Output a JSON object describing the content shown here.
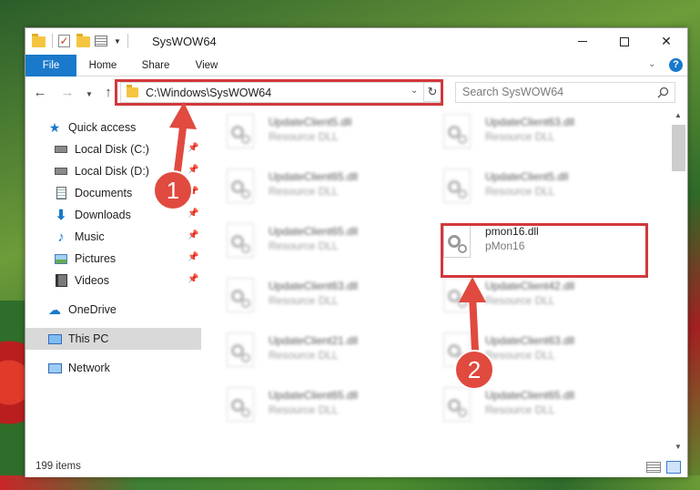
{
  "window": {
    "title": "SysWOW64"
  },
  "ribbon": {
    "tabs": [
      "File",
      "Home",
      "Share",
      "View"
    ]
  },
  "nav": {
    "address": "C:\\Windows\\SysWOW64",
    "search_placeholder": "Search SysWOW64"
  },
  "navpane": {
    "items": [
      {
        "label": "Quick access",
        "icon": "star-icon",
        "pinned": false
      },
      {
        "label": "Local Disk (C:)",
        "icon": "drive-icon",
        "pinned": true
      },
      {
        "label": "Local Disk (D:)",
        "icon": "drive-icon",
        "pinned": true
      },
      {
        "label": "Documents",
        "icon": "document-icon",
        "pinned": true
      },
      {
        "label": "Downloads",
        "icon": "download-icon",
        "pinned": true
      },
      {
        "label": "Music",
        "icon": "music-icon",
        "pinned": true
      },
      {
        "label": "Pictures",
        "icon": "picture-icon",
        "pinned": true
      },
      {
        "label": "Videos",
        "icon": "video-icon",
        "pinned": true
      },
      {
        "label": "OneDrive",
        "icon": "cloud-icon",
        "pinned": false
      },
      {
        "label": "This PC",
        "icon": "computer-icon",
        "pinned": false,
        "selected": true
      },
      {
        "label": "Network",
        "icon": "network-icon",
        "pinned": false
      }
    ]
  },
  "files": [
    {
      "name": "UpdateClient5.dll",
      "desc": "Resource DLL"
    },
    {
      "name": "UpdateClient63.dll",
      "desc": "Resource DLL"
    },
    {
      "name": "UpdateClient65.dll",
      "desc": "Resource DLL"
    },
    {
      "name": "UpdateClient5.dll",
      "desc": "Resource DLL"
    },
    {
      "name": "UpdateClient65.dll",
      "desc": "Resource DLL"
    },
    {
      "name": "pmon16.dll",
      "desc": "pMon16"
    },
    {
      "name": "UpdateClient63.dll",
      "desc": "Resource DLL"
    },
    {
      "name": "UpdateClient42.dll",
      "desc": "Resource DLL"
    },
    {
      "name": "UpdateClient21.dll",
      "desc": "Resource DLL"
    },
    {
      "name": "UpdateClient63.dll",
      "desc": "Resource DLL"
    },
    {
      "name": "UpdateClient65.dll",
      "desc": "Resource DLL"
    },
    {
      "name": "UpdateClient65.dll",
      "desc": "Resource DLL"
    }
  ],
  "status": {
    "count": "199 items"
  },
  "annotations": [
    {
      "label": "1"
    },
    {
      "label": "2"
    }
  ],
  "colors": {
    "accent": "#1979ca",
    "highlight": "#d2383c",
    "badge": "#e04a3f"
  }
}
